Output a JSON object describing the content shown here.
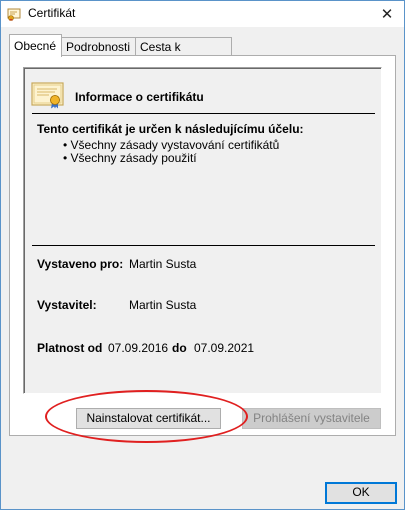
{
  "window": {
    "title": "Certifikát",
    "close_glyph": "✕"
  },
  "tabs": [
    {
      "label": "Obecné",
      "active": true
    },
    {
      "label": "Podrobnosti",
      "active": false
    },
    {
      "label": "Cesta k certifikátu",
      "active": false
    }
  ],
  "info": {
    "title": "Informace o certifikátu",
    "purpose_heading": "Tento certifikát je určen k následujícímu účelu:",
    "purposes": [
      "• Všechny zásady vystavování certifikátů",
      "• Všechny zásady použití"
    ],
    "issued_to_label": "Vystaveno pro:",
    "issued_to_value": "Martin Susta",
    "issuer_label": "Vystavitel:",
    "issuer_value": "Martin Susta",
    "valid_from_label": "Platnost od",
    "valid_from_value": "07.09.2016",
    "valid_to_label": "do",
    "valid_to_value": "07.09.2021"
  },
  "buttons": {
    "install_label": "Nainstalovat certifikát...",
    "issuer_statement_label": "Prohlášení vystavitele",
    "ok_label": "OK"
  },
  "icons": {
    "window_icon": "certificate-icon",
    "info_icon": "certificate-icon",
    "close_icon": "close-icon"
  },
  "colors": {
    "annotation": "#e02020",
    "window_border": "#5a93c9",
    "default_button_border": "#0078d7"
  }
}
